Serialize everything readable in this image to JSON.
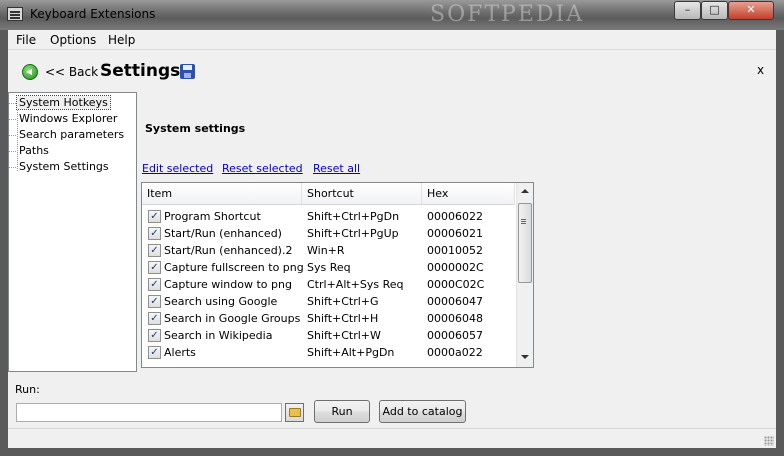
{
  "window": {
    "title": "Keyboard Extensions",
    "watermark": "SOFTPEDIA",
    "buttons": {
      "minimize": "–",
      "maximize": "□",
      "close": "✕"
    }
  },
  "menu": {
    "file": "File",
    "options": "Options",
    "help": "Help"
  },
  "header": {
    "back_label": "<< Back",
    "title": "Settings",
    "close_label": "x"
  },
  "tree": {
    "items": [
      {
        "label": "System Hotkeys",
        "selected": true
      },
      {
        "label": "Windows Explorer",
        "selected": false
      },
      {
        "label": "Search parameters",
        "selected": false
      },
      {
        "label": "Paths",
        "selected": false
      },
      {
        "label": "System Settings",
        "selected": false
      }
    ]
  },
  "main": {
    "section_title": "System settings",
    "links": {
      "edit": "Edit selected",
      "reset": "Reset selected",
      "reset_all": "Reset all"
    },
    "columns": [
      "Item",
      "Shortcut",
      "Hex"
    ],
    "rows": [
      {
        "item": "Program Shortcut",
        "shortcut": "Shift+Ctrl+PgDn",
        "hex": "00006022",
        "checked": true
      },
      {
        "item": "Start/Run (enhanced)",
        "shortcut": "Shift+Ctrl+PgUp",
        "hex": "00006021",
        "checked": true
      },
      {
        "item": "Start/Run (enhanced).2",
        "shortcut": "Win+R",
        "hex": "00010052",
        "checked": true
      },
      {
        "item": "Capture fullscreen to png",
        "shortcut": "Sys Req",
        "hex": "0000002C",
        "checked": true
      },
      {
        "item": "Capture window to png",
        "shortcut": "Ctrl+Alt+Sys Req",
        "hex": "0000C02C",
        "checked": true
      },
      {
        "item": "Search using Google",
        "shortcut": "Shift+Ctrl+G",
        "hex": "00006047",
        "checked": true
      },
      {
        "item": "Search in Google Groups",
        "shortcut": "Shift+Ctrl+H",
        "hex": "00006048",
        "checked": true
      },
      {
        "item": "Search in Wikipedia",
        "shortcut": "Shift+Ctrl+W",
        "hex": "00006057",
        "checked": true
      },
      {
        "item": "Alerts",
        "shortcut": "Shift+Alt+PgDn",
        "hex": "0000a022",
        "checked": true
      }
    ]
  },
  "run": {
    "label": "Run:",
    "value": "",
    "run_button": "Run",
    "catalog_button": "Add to catalog"
  },
  "colors": {
    "link": "#0000cc",
    "titlebar": "#6e6e6e",
    "panel": "#f0f0f0"
  }
}
